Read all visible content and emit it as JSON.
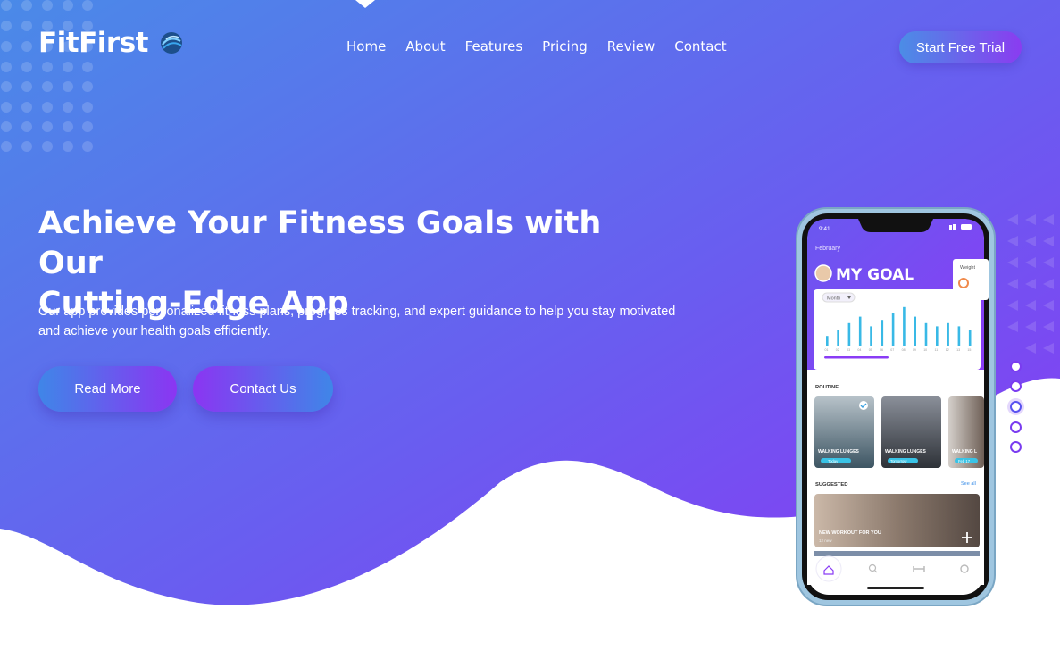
{
  "brand": {
    "name": "FitFirst",
    "logo_icon": "globe-logo-icon"
  },
  "nav": {
    "items": [
      {
        "label": "Home"
      },
      {
        "label": "About"
      },
      {
        "label": "Features"
      },
      {
        "label": "Pricing"
      },
      {
        "label": "Review"
      },
      {
        "label": "Contact"
      }
    ],
    "cta_label": "Start Free Trial"
  },
  "hero": {
    "headline_line1": "Achieve Your Fitness Goals with Our",
    "headline_line2": "Cutting-Edge App",
    "subtext_line1": "Our app provides personalized fitness plans, progress tracking, and expert guidance to help you stay motivated",
    "subtext_line2": "and achieve your health goals efficiently.",
    "read_more_label": "Read More",
    "contact_label": "Contact Us"
  },
  "slider": {
    "count": 5,
    "active_index": 2
  },
  "phone_screen": {
    "time": "9:41",
    "month": "February",
    "goal_title": "MY GOAL",
    "period_select": "Month",
    "weight_label": "Weight",
    "bar_values": [
      3,
      5,
      7,
      9,
      6,
      8,
      10,
      12,
      9,
      7,
      6,
      7,
      6,
      5
    ],
    "day_labels": [
      "01",
      "02",
      "03",
      "04",
      "05",
      "06",
      "07",
      "08",
      "09",
      "10",
      "11",
      "12",
      "13",
      "15"
    ],
    "routine_label": "ROUTINE",
    "routine_cards": [
      {
        "title": "WALKING LUNGES",
        "tag": "Today"
      },
      {
        "title": "WALKING LUNGES",
        "tag": "Tomorrow"
      },
      {
        "title": "WALKING L",
        "tag": "Feb 17"
      }
    ],
    "suggested_label": "SUGGESTED",
    "see_all": "See all",
    "workout_title": "NEW WORKOUT FOR YOU",
    "workout_sub": "12 new"
  },
  "colors": {
    "gradient_start": "#4a8ae8",
    "gradient_end": "#8a38f5",
    "accent": "#7a3cf0"
  }
}
